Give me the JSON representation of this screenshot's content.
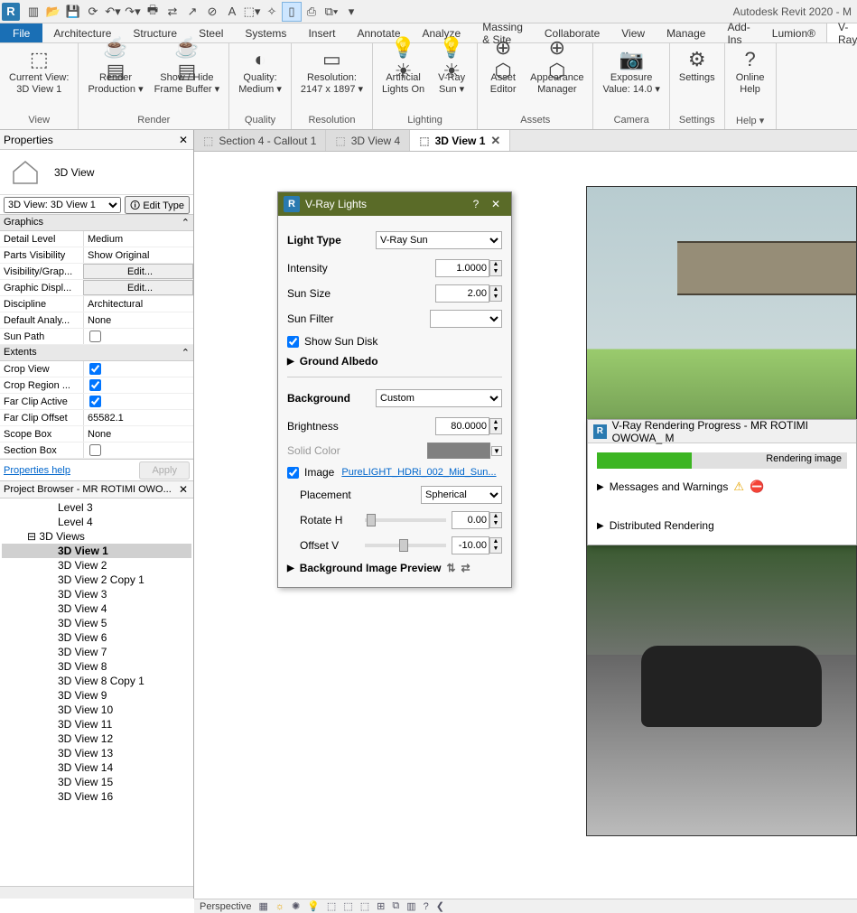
{
  "app": {
    "title": "Autodesk Revit 2020 - M"
  },
  "menubar": {
    "file": "File",
    "tabs": [
      "Architecture",
      "Structure",
      "Steel",
      "Systems",
      "Insert",
      "Annotate",
      "Analyze",
      "Massing & Site",
      "Collaborate",
      "View",
      "Manage",
      "Add-Ins",
      "Lumion®",
      "V-Ray"
    ],
    "active_index": 13
  },
  "ribbon": {
    "groups": [
      {
        "label": "View",
        "buttons": [
          {
            "label": "Current View:\n3D View 1"
          }
        ]
      },
      {
        "label": "Render",
        "buttons": [
          {
            "label": "Render\nProduction ▾"
          },
          {
            "label": "Show / Hide\nFrame Buffer ▾"
          }
        ]
      },
      {
        "label": "Quality",
        "buttons": [
          {
            "label": "Quality:\nMedium ▾"
          }
        ]
      },
      {
        "label": "Resolution",
        "buttons": [
          {
            "label": "Resolution:\n2147 x 1897 ▾"
          }
        ]
      },
      {
        "label": "Lighting",
        "buttons": [
          {
            "label": "Artificial\nLights On"
          },
          {
            "label": "V-Ray\nSun ▾"
          }
        ]
      },
      {
        "label": "Assets",
        "buttons": [
          {
            "label": "Asset\nEditor"
          },
          {
            "label": "Appearance\nManager"
          }
        ]
      },
      {
        "label": "Camera",
        "buttons": [
          {
            "label": "Exposure\nValue: 14.0 ▾"
          }
        ]
      },
      {
        "label": "Settings",
        "buttons": [
          {
            "label": "Settings"
          }
        ]
      },
      {
        "label": "Help ▾",
        "buttons": [
          {
            "label": "Online\nHelp"
          }
        ]
      }
    ]
  },
  "properties": {
    "title": "Properties",
    "type_name": "3D View",
    "instance_select": "3D View: 3D View 1",
    "edit_type": "Edit Type",
    "sections": {
      "graphics": "Graphics",
      "extents": "Extents"
    },
    "rows": [
      {
        "k": "Detail Level",
        "v": "Medium",
        "type": "text"
      },
      {
        "k": "Parts Visibility",
        "v": "Show Original",
        "type": "text"
      },
      {
        "k": "Visibility/Grap...",
        "v": "Edit...",
        "type": "btn"
      },
      {
        "k": "Graphic Displ...",
        "v": "Edit...",
        "type": "btn"
      },
      {
        "k": "Discipline",
        "v": "Architectural",
        "type": "text"
      },
      {
        "k": "Default Analy...",
        "v": "None",
        "type": "text"
      },
      {
        "k": "Sun Path",
        "v": "",
        "type": "check",
        "checked": false
      }
    ],
    "extent_rows": [
      {
        "k": "Crop View",
        "v": "",
        "type": "check",
        "checked": true
      },
      {
        "k": "Crop Region ...",
        "v": "",
        "type": "check",
        "checked": true
      },
      {
        "k": "Far Clip Active",
        "v": "",
        "type": "check",
        "checked": true
      },
      {
        "k": "Far Clip Offset",
        "v": "65582.1",
        "type": "text"
      },
      {
        "k": "Scope Box",
        "v": "None",
        "type": "text"
      },
      {
        "k": "Section Box",
        "v": "",
        "type": "check",
        "checked": false
      }
    ],
    "help_link": "Properties help",
    "apply": "Apply"
  },
  "browser": {
    "title": "Project Browser - MR ROTIMI OWO...",
    "nodes": [
      {
        "label": "Level 3",
        "indent": "ind0b"
      },
      {
        "label": "Level 4",
        "indent": "ind0b"
      },
      {
        "label": "3D Views",
        "indent": "ind2",
        "expander": "⊟"
      },
      {
        "label": "3D View 1",
        "indent": "ind0b",
        "selected": true
      },
      {
        "label": "3D View 2",
        "indent": "ind0b"
      },
      {
        "label": "3D View 2 Copy 1",
        "indent": "ind0b"
      },
      {
        "label": "3D View 3",
        "indent": "ind0b"
      },
      {
        "label": "3D View 4",
        "indent": "ind0b"
      },
      {
        "label": "3D View 5",
        "indent": "ind0b"
      },
      {
        "label": "3D View 6",
        "indent": "ind0b"
      },
      {
        "label": "3D View 7",
        "indent": "ind0b"
      },
      {
        "label": "3D View 8",
        "indent": "ind0b"
      },
      {
        "label": "3D View 8 Copy 1",
        "indent": "ind0b"
      },
      {
        "label": "3D View 9",
        "indent": "ind0b"
      },
      {
        "label": "3D View 10",
        "indent": "ind0b"
      },
      {
        "label": "3D View 11",
        "indent": "ind0b"
      },
      {
        "label": "3D View 12",
        "indent": "ind0b"
      },
      {
        "label": "3D View 13",
        "indent": "ind0b"
      },
      {
        "label": "3D View 14",
        "indent": "ind0b"
      },
      {
        "label": "3D View 15",
        "indent": "ind0b"
      },
      {
        "label": "3D View 16",
        "indent": "ind0b"
      }
    ]
  },
  "view_tabs": [
    {
      "label": "Section 4 - Callout 1",
      "active": false,
      "closable": false
    },
    {
      "label": "3D View 4",
      "active": false,
      "closable": false
    },
    {
      "label": "3D View 1",
      "active": true,
      "closable": true
    }
  ],
  "vray_lights": {
    "title": "V-Ray Lights",
    "light_type_label": "Light Type",
    "light_type_value": "V-Ray Sun",
    "intensity_label": "Intensity",
    "intensity_value": "1.0000",
    "sun_size_label": "Sun Size",
    "sun_size_value": "2.00",
    "sun_filter_label": "Sun Filter",
    "show_sun_disk": "Show Sun Disk",
    "show_sun_disk_checked": true,
    "ground_albedo": "Ground Albedo",
    "background_label": "Background",
    "background_value": "Custom",
    "brightness_label": "Brightness",
    "brightness_value": "80.0000",
    "solid_color_label": "Solid Color",
    "image_label": "Image",
    "image_checked": true,
    "image_link": "PureLIGHT_HDRi_002_Mid_Sun...",
    "placement_label": "Placement",
    "placement_value": "Spherical",
    "rotate_h_label": "Rotate H",
    "rotate_h_value": "0.00",
    "offset_v_label": "Offset V",
    "offset_v_value": "-10.00",
    "bg_preview": "Background Image Preview"
  },
  "progress": {
    "title": "V-Ray Rendering Progress - MR ROTIMI OWOWA_ M",
    "bar_text": "Rendering image",
    "messages": "Messages and Warnings",
    "distributed": "Distributed Rendering"
  },
  "statusbar": {
    "mode": "Perspective"
  }
}
